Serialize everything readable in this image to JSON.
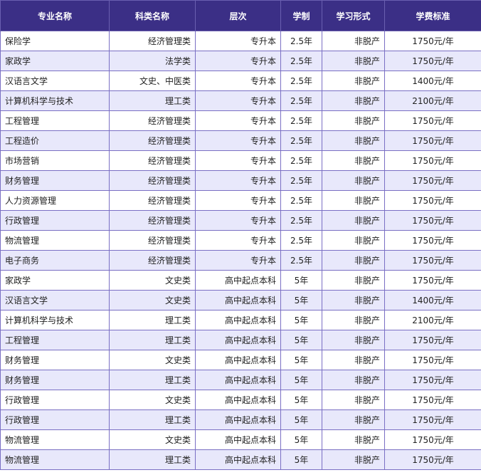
{
  "headers": [
    "专业名称",
    "科类名称",
    "层次",
    "学制",
    "学习形式",
    "学费标准"
  ],
  "rows": [
    {
      "name": "保险学",
      "category": "经济管理类",
      "level": "专升本",
      "duration": "2.5年",
      "mode": "非脱产",
      "fee": "1750元/年"
    },
    {
      "name": "家政学",
      "category": "法学类",
      "level": "专升本",
      "duration": "2.5年",
      "mode": "非脱产",
      "fee": "1750元/年"
    },
    {
      "name": "汉语言文学",
      "category": "文史、中医类",
      "level": "专升本",
      "duration": "2.5年",
      "mode": "非脱产",
      "fee": "1400元/年"
    },
    {
      "name": "计算机科学与技术",
      "category": "理工类",
      "level": "专升本",
      "duration": "2.5年",
      "mode": "非脱产",
      "fee": "2100元/年"
    },
    {
      "name": "工程管理",
      "category": "经济管理类",
      "level": "专升本",
      "duration": "2.5年",
      "mode": "非脱产",
      "fee": "1750元/年"
    },
    {
      "name": "工程造价",
      "category": "经济管理类",
      "level": "专升本",
      "duration": "2.5年",
      "mode": "非脱产",
      "fee": "1750元/年"
    },
    {
      "name": "市场营销",
      "category": "经济管理类",
      "level": "专升本",
      "duration": "2.5年",
      "mode": "非脱产",
      "fee": "1750元/年"
    },
    {
      "name": "财务管理",
      "category": "经济管理类",
      "level": "专升本",
      "duration": "2.5年",
      "mode": "非脱产",
      "fee": "1750元/年"
    },
    {
      "name": "人力资源管理",
      "category": "经济管理类",
      "level": "专升本",
      "duration": "2.5年",
      "mode": "非脱产",
      "fee": "1750元/年"
    },
    {
      "name": "行政管理",
      "category": "经济管理类",
      "level": "专升本",
      "duration": "2.5年",
      "mode": "非脱产",
      "fee": "1750元/年"
    },
    {
      "name": "物流管理",
      "category": "经济管理类",
      "level": "专升本",
      "duration": "2.5年",
      "mode": "非脱产",
      "fee": "1750元/年"
    },
    {
      "name": "电子商务",
      "category": "经济管理类",
      "level": "专升本",
      "duration": "2.5年",
      "mode": "非脱产",
      "fee": "1750元/年"
    },
    {
      "name": "家政学",
      "category": "文史类",
      "level": "高中起点本科",
      "duration": "5年",
      "mode": "非脱产",
      "fee": "1750元/年"
    },
    {
      "name": "汉语言文学",
      "category": "文史类",
      "level": "高中起点本科",
      "duration": "5年",
      "mode": "非脱产",
      "fee": "1400元/年"
    },
    {
      "name": "计算机科学与技术",
      "category": "理工类",
      "level": "高中起点本科",
      "duration": "5年",
      "mode": "非脱产",
      "fee": "2100元/年"
    },
    {
      "name": "工程管理",
      "category": "理工类",
      "level": "高中起点本科",
      "duration": "5年",
      "mode": "非脱产",
      "fee": "1750元/年"
    },
    {
      "name": "财务管理",
      "category": "文史类",
      "level": "高中起点本科",
      "duration": "5年",
      "mode": "非脱产",
      "fee": "1750元/年"
    },
    {
      "name": "财务管理",
      "category": "理工类",
      "level": "高中起点本科",
      "duration": "5年",
      "mode": "非脱产",
      "fee": "1750元/年"
    },
    {
      "name": "行政管理",
      "category": "文史类",
      "level": "高中起点本科",
      "duration": "5年",
      "mode": "非脱产",
      "fee": "1750元/年"
    },
    {
      "name": "行政管理",
      "category": "理工类",
      "level": "高中起点本科",
      "duration": "5年",
      "mode": "非脱产",
      "fee": "1750元/年"
    },
    {
      "name": "物流管理",
      "category": "文史类",
      "level": "高中起点本科",
      "duration": "5年",
      "mode": "非脱产",
      "fee": "1750元/年"
    },
    {
      "name": "物流管理",
      "category": "理工类",
      "level": "高中起点本科",
      "duration": "5年",
      "mode": "非脱产",
      "fee": "1750元/年"
    }
  ],
  "colors": {
    "header_bg": "#3b2f86",
    "header_text": "#ffffff",
    "row_alt_bg": "#e8e8fb",
    "border": "#7a6fc4"
  }
}
